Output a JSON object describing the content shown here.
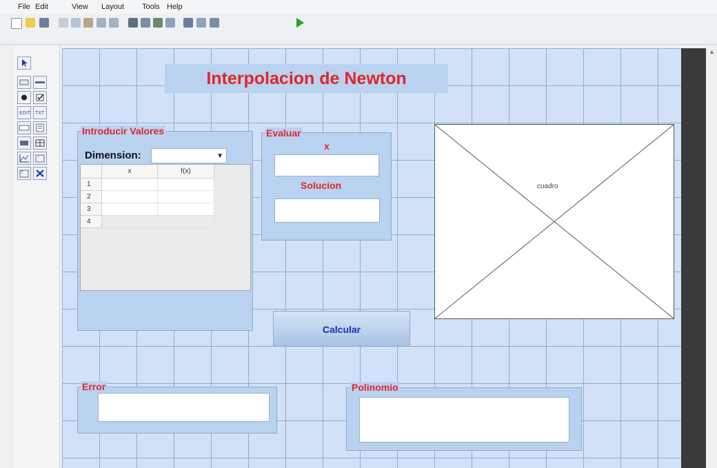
{
  "menu": [
    "File",
    "Edit",
    "View",
    "Layout",
    "Tools",
    "Help"
  ],
  "toolbar_icons": [
    "new-file-icon",
    "open-folder-icon",
    "save-icon",
    "cut-icon",
    "copy-icon",
    "paste-icon",
    "undo-icon",
    "redo-icon",
    "align-icon",
    "editor-icon",
    "property-inspector-icon",
    "object-browser-icon",
    "tab-order-icon",
    "menu-editor-icon",
    "toolbar-editor-icon",
    "run-icon"
  ],
  "palette_icons": [
    "select-icon",
    "push-button-icon",
    "slider-icon",
    "radio-button-icon",
    "checkbox-icon",
    "edit-text-icon",
    "static-text-icon",
    "popup-menu-icon",
    "listbox-icon",
    "toggle-button-icon",
    "table-icon",
    "axes-icon",
    "panel-icon",
    "button-group-icon",
    "activex-icon"
  ],
  "title": "Interpolacion de Newton",
  "introducir": {
    "title": "Introducir Valores",
    "dimension_label": "Dimension:",
    "dimension_value": "",
    "table": {
      "columns": [
        "x",
        "f(x)"
      ],
      "rows": [
        "1",
        "2",
        "3",
        "4"
      ]
    }
  },
  "evaluar": {
    "title": "Evaluar",
    "x_label": "x",
    "x_value": "",
    "solucion_label": "Solucion",
    "solucion_value": ""
  },
  "axes_tag": "cuadro",
  "calcular_label": "Calcular",
  "error": {
    "title": "Error",
    "value": ""
  },
  "polinomio": {
    "title": "Polinomio",
    "value": ""
  },
  "colors": {
    "accent_red": "#e0252b",
    "panel": "#b9d2ef",
    "canvas": "#d1e2f8",
    "button_text": "#1a2fa8"
  }
}
